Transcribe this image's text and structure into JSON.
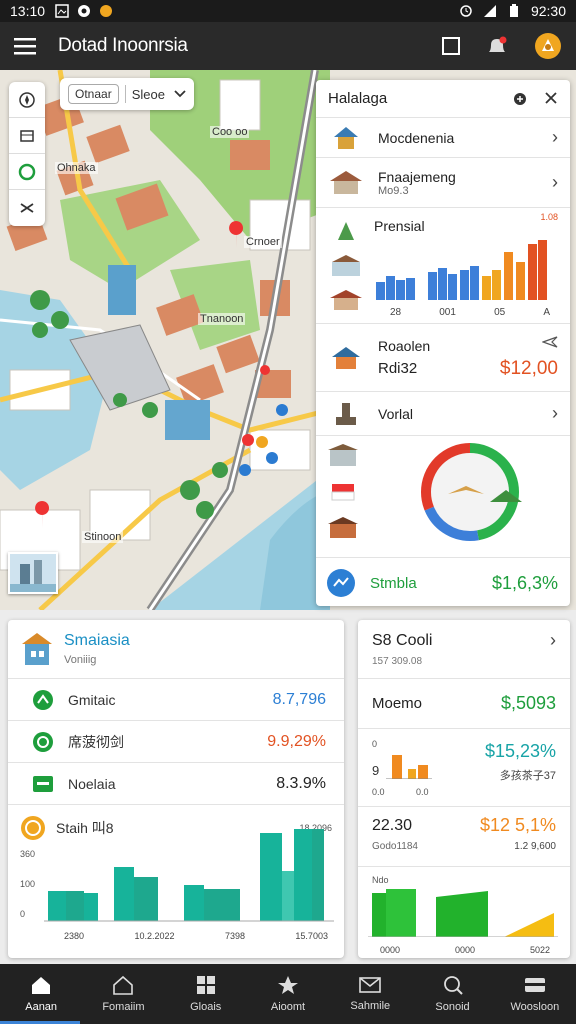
{
  "status": {
    "time_left": "13:10",
    "time_right": "92:30"
  },
  "appbar": {
    "title": "Dotad Inoonrsia"
  },
  "map": {
    "search_chip": "Otnaar",
    "search_text": "Sleoe",
    "labels": [
      "Coo oo",
      "Ohnaka",
      "Crnoer",
      "Tnanoon",
      "Stinoon"
    ]
  },
  "panel": {
    "title": "Halalaga",
    "rows": [
      {
        "title": "Mocdenenia"
      },
      {
        "title": "Fnaajemeng",
        "sub": "Mo9.3"
      },
      {
        "title": "Prensial",
        "badge": "1.08"
      },
      {
        "title": "Roaolen",
        "sub": "Rdi32",
        "value": "$12,00"
      },
      {
        "title": "Vorlal"
      }
    ],
    "chart_xlabels": [
      "28",
      "001",
      "05",
      "A"
    ],
    "footer_label": "Stmbla",
    "footer_value": "$1,6,3%"
  },
  "left_card": {
    "title": "Smaiasia",
    "subtitle": "Voniiig",
    "rows": [
      {
        "label": "Gmitaic",
        "value": "8.7,796"
      },
      {
        "label": "席菠彻剑",
        "value": "9.9,29%"
      },
      {
        "label": "Noelaia",
        "value": "8.3.9%"
      }
    ],
    "chart_title": "Staih 叫8",
    "chart_corner": "18.2096",
    "y_ticks": [
      "360",
      "100",
      "0"
    ],
    "x_ticks": [
      "2380",
      "10.2.2022",
      "7398",
      "15.7003"
    ]
  },
  "right_card": {
    "title": "S8 Cooli",
    "subtitle": "157 309.08",
    "row1_label": "Moemo",
    "row1_value": "$,5093",
    "row2_value": "$15,23%",
    "row2_sub": "多孩茶子37",
    "row2_ticks": [
      "0",
      "9",
      "0.0",
      "0.0"
    ],
    "row3_left": "22.30",
    "row3_left_sub": "Godo1184",
    "row3_value": "$12 5,1%",
    "row3_sub": "1.2 9,600",
    "chart_label": "Ndo",
    "x_ticks": [
      "0000",
      "0000",
      "5022"
    ]
  },
  "bottom_nav": {
    "items": [
      {
        "label": "Aanan"
      },
      {
        "label": "Fomaiim"
      },
      {
        "label": "Gloais"
      },
      {
        "label": "Aioomt"
      },
      {
        "label": "Sahmile"
      },
      {
        "label": "Sonoid"
      },
      {
        "label": "Woosloon"
      }
    ]
  },
  "colors": {
    "accent_green": "#1e9e3c",
    "accent_red": "#e25222",
    "accent_blue": "#2c7fd4",
    "teal": "#17b39a"
  }
}
